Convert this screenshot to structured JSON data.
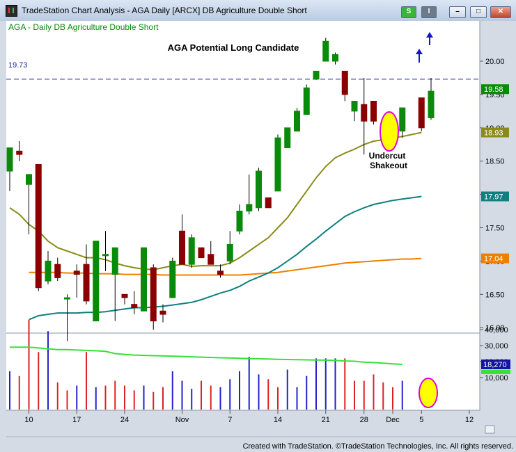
{
  "window": {
    "title": "TradeStation Chart Analysis - AGA Daily [ARCX] DB Agriculture Double Short",
    "buttons": {
      "s": "S",
      "layout": "I",
      "minimize": "–",
      "maximize": "□",
      "close": "✕"
    },
    "footer": "Created with TradeStation. ©TradeStation Technologies, Inc. All rights reserved."
  },
  "chart_data": {
    "type": "candlestick",
    "symbol_label": "AGA - Daily  DB Agriculture Double Short",
    "title": "AGA Potential Long Candidate",
    "annotation": {
      "line1": "Undercut",
      "line2": "Shakeout"
    },
    "resistance": {
      "label": "19.73",
      "value": 19.73
    },
    "price_axis": {
      "ticks": [
        16.0,
        16.5,
        17.0,
        17.5,
        18.0,
        18.5,
        19.0,
        19.5,
        20.0
      ],
      "tick_labels": [
        "16.00",
        "16.50",
        "17.00",
        "17.50",
        "18.00",
        "18.50",
        "19.00",
        "19.50",
        "20.00"
      ],
      "ylim": [
        15.7,
        20.52
      ]
    },
    "price_tags": [
      {
        "label": "19.58",
        "value": 19.58,
        "bg": "#0a8a0a",
        "fg": "#ffffff"
      },
      {
        "label": "18.93",
        "value": 18.93,
        "bg": "#8b8b1a",
        "fg": "#ffffff"
      },
      {
        "label": "17.97",
        "value": 17.97,
        "bg": "#0f7f7f",
        "fg": "#ffffff"
      },
      {
        "label": "17.04",
        "value": 17.04,
        "bg": "#f07f00",
        "fg": "#ffffff"
      }
    ],
    "x_labels": [
      {
        "label": "10",
        "index": 2
      },
      {
        "label": "17",
        "index": 7
      },
      {
        "label": "24",
        "index": 12
      },
      {
        "label": "Nov",
        "index": 18
      },
      {
        "label": "7",
        "index": 23
      },
      {
        "label": "14",
        "index": 28
      },
      {
        "label": "21",
        "index": 33
      },
      {
        "label": "28",
        "index": 37
      },
      {
        "label": "Dec",
        "index": 40
      },
      {
        "label": "5",
        "index": 43
      },
      {
        "label": "12",
        "index": 48
      }
    ],
    "candles": [
      {
        "o": 18.35,
        "h": 18.65,
        "l": 18.05,
        "c": 18.7
      },
      {
        "o": 18.65,
        "h": 18.8,
        "l": 18.5,
        "c": 18.6
      },
      {
        "o": 18.15,
        "h": 18.3,
        "l": 17.4,
        "c": 18.3
      },
      {
        "o": 18.45,
        "h": 18.45,
        "l": 16.55,
        "c": 16.6
      },
      {
        "o": 16.7,
        "h": 17.15,
        "l": 16.65,
        "c": 17.0
      },
      {
        "o": 16.95,
        "h": 17.05,
        "l": 16.7,
        "c": 16.75
      },
      {
        "o": 16.45,
        "h": 16.5,
        "l": 15.8,
        "c": 16.45
      },
      {
        "o": 16.85,
        "h": 16.95,
        "l": 16.45,
        "c": 16.8
      },
      {
        "o": 16.95,
        "h": 17.25,
        "l": 16.35,
        "c": 16.4
      },
      {
        "o": 16.1,
        "h": 17.3,
        "l": 16.1,
        "c": 17.3
      },
      {
        "o": 17.1,
        "h": 17.45,
        "l": 16.85,
        "c": 17.1
      },
      {
        "o": 16.8,
        "h": 17.2,
        "l": 16.1,
        "c": 17.2
      },
      {
        "o": 16.5,
        "h": 16.5,
        "l": 16.35,
        "c": 16.45
      },
      {
        "o": 16.35,
        "h": 16.55,
        "l": 16.2,
        "c": 16.3
      },
      {
        "o": 16.25,
        "h": 17.2,
        "l": 16.25,
        "c": 17.2
      },
      {
        "o": 16.9,
        "h": 16.95,
        "l": 15.97,
        "c": 16.1
      },
      {
        "o": 16.25,
        "h": 16.35,
        "l": 16.08,
        "c": 16.2
      },
      {
        "o": 16.45,
        "h": 17.05,
        "l": 16.45,
        "c": 17.0
      },
      {
        "o": 17.45,
        "h": 17.7,
        "l": 16.95,
        "c": 16.95
      },
      {
        "o": 16.95,
        "h": 17.4,
        "l": 16.9,
        "c": 17.35
      },
      {
        "o": 17.2,
        "h": 17.2,
        "l": 17.05,
        "c": 17.05
      },
      {
        "o": 17.1,
        "h": 17.3,
        "l": 16.95,
        "c": 16.95
      },
      {
        "o": 16.85,
        "h": 16.95,
        "l": 16.75,
        "c": 16.8
      },
      {
        "o": 17.0,
        "h": 17.45,
        "l": 16.95,
        "c": 17.25
      },
      {
        "o": 17.45,
        "h": 17.85,
        "l": 17.4,
        "c": 17.75
      },
      {
        "o": 17.75,
        "h": 18.3,
        "l": 17.7,
        "c": 17.85
      },
      {
        "o": 17.8,
        "h": 18.4,
        "l": 17.75,
        "c": 18.35
      },
      {
        "o": 17.95,
        "h": 17.95,
        "l": 17.8,
        "c": 17.8
      },
      {
        "o": 18.05,
        "h": 18.9,
        "l": 18.05,
        "c": 18.85
      },
      {
        "o": 18.7,
        "h": 19.0,
        "l": 18.7,
        "c": 19.0
      },
      {
        "o": 18.95,
        "h": 19.3,
        "l": 18.95,
        "c": 19.25
      },
      {
        "o": 19.2,
        "h": 19.65,
        "l": 19.2,
        "c": 19.6
      },
      {
        "o": 19.73,
        "h": 19.85,
        "l": 19.72,
        "c": 19.85
      },
      {
        "o": 20.0,
        "h": 20.35,
        "l": 20.0,
        "c": 20.3
      },
      {
        "o": 20.0,
        "h": 20.13,
        "l": 19.95,
        "c": 20.1
      },
      {
        "o": 19.85,
        "h": 19.85,
        "l": 19.4,
        "c": 19.5
      },
      {
        "o": 19.25,
        "h": 19.4,
        "l": 19.1,
        "c": 19.4
      },
      {
        "o": 19.35,
        "h": 19.75,
        "l": 18.6,
        "c": 19.1
      },
      {
        "o": 19.4,
        "h": 19.4,
        "l": 19.05,
        "c": 19.1
      },
      {
        "o": 18.95,
        "h": 19.3,
        "l": 18.85,
        "c": 19.3
      },
      {
        "o": 19.45,
        "h": 19.45,
        "l": 18.95,
        "c": 19.0
      },
      {
        "o": 19.15,
        "h": 19.75,
        "l": 19.12,
        "c": 19.55
      }
    ],
    "candle_indexes": [
      0,
      1,
      2,
      3,
      4,
      5,
      6,
      7,
      8,
      9,
      10,
      11,
      12,
      13,
      14,
      15,
      16,
      17,
      18,
      19,
      20,
      21,
      22,
      23,
      24,
      25,
      26,
      27,
      28,
      29,
      30,
      31,
      32,
      33,
      34,
      35,
      36,
      37,
      38,
      41,
      43,
      44
    ],
    "ma_20": [
      17.8,
      17.7,
      17.55,
      17.45,
      17.3,
      17.2,
      17.15,
      17.1,
      17.05,
      17.05,
      17.02,
      16.97,
      16.93,
      16.9,
      16.88,
      16.87,
      16.9,
      16.93,
      16.95,
      16.92,
      16.93,
      16.93,
      16.93,
      16.97,
      17.05,
      17.15,
      17.25,
      17.35,
      17.5,
      17.65,
      17.85,
      18.05,
      18.25,
      18.42,
      18.55,
      18.62,
      18.68,
      18.75,
      18.8,
      18.82,
      18.85,
      18.87,
      18.9,
      18.93
    ],
    "ma_50": [
      16.12,
      16.18,
      16.2,
      16.22,
      16.22,
      16.22,
      16.23,
      16.23,
      16.24,
      16.26,
      16.28,
      16.3,
      16.3,
      16.31,
      16.32,
      16.34,
      16.36,
      16.38,
      16.42,
      16.47,
      16.52,
      16.56,
      16.62,
      16.7,
      16.76,
      16.82,
      16.9,
      17.0,
      17.1,
      17.22,
      17.33,
      17.45,
      17.56,
      17.67,
      17.74,
      17.8,
      17.85,
      17.88,
      17.91,
      17.93,
      17.95,
      17.97
    ],
    "ma_200": [
      16.83,
      16.83,
      16.83,
      16.83,
      16.82,
      16.82,
      16.82,
      16.81,
      16.81,
      16.81,
      16.8,
      16.8,
      16.8,
      16.8,
      16.79,
      16.79,
      16.79,
      16.79,
      16.79,
      16.79,
      16.79,
      16.79,
      16.79,
      16.8,
      16.81,
      16.82,
      16.83,
      16.85,
      16.87,
      16.89,
      16.91,
      16.93,
      16.95,
      16.97,
      16.98,
      16.99,
      17.0,
      17.01,
      17.02,
      17.03,
      17.03,
      17.04
    ],
    "volume_axis": {
      "ticks": [
        10000,
        20000,
        30000,
        40000
      ],
      "tick_labels": [
        "10,000",
        "20,000",
        "30,000",
        "40,000"
      ],
      "ylim": [
        0,
        48000
      ]
    },
    "volume_tag": {
      "label": "18,270",
      "value": 18270
    },
    "volume": [
      {
        "v": 14000,
        "color": "blue"
      },
      {
        "v": 11000,
        "color": "red"
      },
      {
        "v": 46000,
        "color": "red"
      },
      {
        "v": 26000,
        "color": "red"
      },
      {
        "v": 39000,
        "color": "blue"
      },
      {
        "v": 7000,
        "color": "red"
      },
      {
        "v": 2000,
        "color": "red"
      },
      {
        "v": 5000,
        "color": "blue"
      },
      {
        "v": 26000,
        "color": "red"
      },
      {
        "v": 4000,
        "color": "blue"
      },
      {
        "v": 5000,
        "color": "red"
      },
      {
        "v": 8000,
        "color": "red"
      },
      {
        "v": 5000,
        "color": "red"
      },
      {
        "v": 2000,
        "color": "red"
      },
      {
        "v": 5000,
        "color": "blue"
      },
      {
        "v": 1000,
        "color": "red"
      },
      {
        "v": 4000,
        "color": "red"
      },
      {
        "v": 14000,
        "color": "blue"
      },
      {
        "v": 8000,
        "color": "blue"
      },
      {
        "v": 3000,
        "color": "blue"
      },
      {
        "v": 8000,
        "color": "red"
      },
      {
        "v": 5000,
        "color": "red"
      },
      {
        "v": 4000,
        "color": "blue"
      },
      {
        "v": 9000,
        "color": "blue"
      },
      {
        "v": 14000,
        "color": "blue"
      },
      {
        "v": 23000,
        "color": "blue"
      },
      {
        "v": 12000,
        "color": "blue"
      },
      {
        "v": 9000,
        "color": "red"
      },
      {
        "v": 4000,
        "color": "red"
      },
      {
        "v": 15000,
        "color": "blue"
      },
      {
        "v": 4000,
        "color": "blue"
      },
      {
        "v": 11000,
        "color": "blue"
      },
      {
        "v": 22000,
        "color": "blue"
      },
      {
        "v": 22000,
        "color": "blue"
      },
      {
        "v": 22000,
        "color": "blue"
      },
      {
        "v": 22000,
        "color": "red"
      },
      {
        "v": 8000,
        "color": "red"
      },
      {
        "v": 8000,
        "color": "red"
      },
      {
        "v": 12000,
        "color": "red"
      },
      {
        "v": 7000,
        "color": "red"
      },
      {
        "v": 4000,
        "color": "red"
      },
      {
        "v": 8000,
        "color": "blue"
      }
    ],
    "volume_ma": [
      29000,
      29000,
      29000,
      28500,
      28000,
      27500,
      27500,
      27200,
      27000,
      26800,
      26400,
      25000,
      24500,
      24100,
      23900,
      23700,
      23600,
      23400,
      23200,
      23000,
      22800,
      22600,
      22400,
      22300,
      22100,
      21900,
      21800,
      21600,
      21400,
      21300,
      21200,
      21100,
      21000,
      20900,
      20700,
      20400,
      20200,
      19700,
      19400,
      19000,
      18600,
      18270
    ],
    "legend_colors": {
      "up": "#0a8a0a",
      "down": "#8b0000",
      "ma20": "#8b8b1a",
      "ma50": "#0f7f7f",
      "ma200": "#f07f00",
      "vol_ma": "#38e038",
      "vol_up": "#2222cc",
      "vol_down": "#dd2222",
      "resistance": "#1a2a9a",
      "highlight": "#ffff00",
      "highlight_border": "#e000e0",
      "arrow": "#1515cc"
    }
  }
}
